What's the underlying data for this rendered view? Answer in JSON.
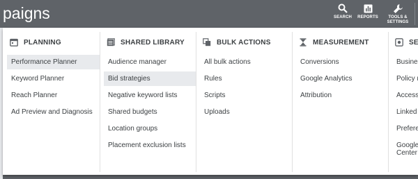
{
  "header": {
    "title": "paigns",
    "buttons": [
      {
        "label": "SEARCH",
        "icon": "search-icon"
      },
      {
        "label": "REPORTS",
        "icon": "reports-icon"
      },
      {
        "label": "TOOLS &\nSETTINGS",
        "icon": "wrench-icon"
      }
    ]
  },
  "menu": {
    "planning": {
      "title": "PLANNING",
      "icon": "calendar-icon",
      "items": [
        "Performance Planner",
        "Keyword Planner",
        "Reach Planner",
        "Ad Preview and Diagnosis"
      ]
    },
    "shared_library": {
      "title": "SHARED LIBRARY",
      "icon": "library-icon",
      "items": [
        "Audience manager",
        "Bid strategies",
        "Negative keyword lists",
        "Shared budgets",
        "Location groups",
        "Placement exclusion lists"
      ]
    },
    "bulk_actions": {
      "title": "BULK ACTIONS",
      "icon": "copy-icon",
      "items": [
        "All bulk actions",
        "Rules",
        "Scripts",
        "Uploads"
      ]
    },
    "measurement": {
      "title": "MEASUREMENT",
      "icon": "hourglass-icon",
      "items": [
        "Conversions",
        "Google Analytics",
        "Attribution"
      ]
    },
    "setup": {
      "title": "SE",
      "icon": "setup-icon",
      "items": [
        "Busines",
        "Policy m",
        "Access",
        "Linked a",
        "Prefere",
        "Google\nCenter"
      ]
    }
  },
  "colors": {
    "topbar": "#5f6368",
    "selected_item": "#e8eaed",
    "text": "#3c4043"
  }
}
